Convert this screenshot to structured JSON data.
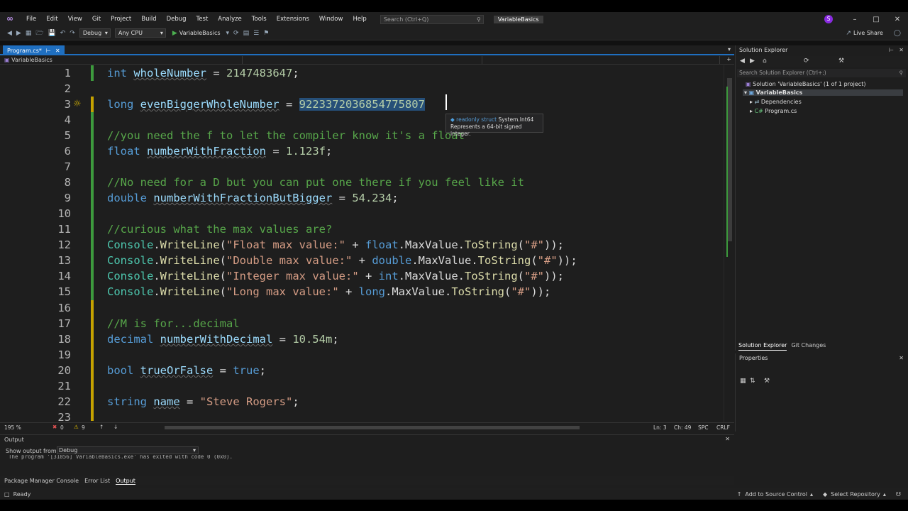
{
  "menu": [
    "File",
    "Edit",
    "View",
    "Git",
    "Project",
    "Build",
    "Debug",
    "Test",
    "Analyze",
    "Tools",
    "Extensions",
    "Window",
    "Help"
  ],
  "search_placeholder": "Search (Ctrl+Q)",
  "solution_name": "VariableBasics",
  "user_initial": "S",
  "toolbar": {
    "config": "Debug",
    "platform": "Any CPU",
    "run_label": "VariableBasics",
    "live_share": "Live Share"
  },
  "editor_tab": {
    "label": "Program.cs*"
  },
  "nav": {
    "scope": "VariableBasics"
  },
  "code": {
    "l1_kw": "int",
    "l1_id": "wholeNumber",
    "l1_rest": " = ",
    "l1_num": "2147483647",
    "l1_end": ";",
    "l3_kw": "long",
    "l3_id": "evenBiggerWholeNumber",
    "l3_rest": " = ",
    "l3_num": "9223372036854775807",
    "l5_cm": "//you need the f to let the compiler know it's a float",
    "l6_kw": "float",
    "l6_id": "numberWithFraction",
    "l6_rest": " = ",
    "l6_num": "1.123f",
    "l6_end": ";",
    "l8_cm": "//No need for a D but you can put one there if you feel like it",
    "l9_kw": "double",
    "l9_id": "numberWithFractionButBigger",
    "l9_rest": " = ",
    "l9_num": "54.234",
    "l9_end": ";",
    "l11_cm": "//curious what the max values are?",
    "l12_str": "\"Float max value:\"",
    "l12_kw": "float",
    "l13_str": "\"Double max value:\"",
    "l13_kw": "double",
    "l14_str": "\"Integer max value:\"",
    "l14_kw": "int",
    "l15_str": "\"Long max value:\"",
    "l15_kw": "long",
    "console": "Console",
    "writeline": "WriteLine",
    "maxvalue": "MaxValue",
    "tostring": "ToString",
    "hash": "\"#\"",
    "l17_cm": "//M is for...decimal",
    "l18_kw": "decimal",
    "l18_id": "numberWithDecimal",
    "l18_rest": " = ",
    "l18_num": "10.54m",
    "l18_end": ";",
    "l20_kw": "bool",
    "l20_id": "trueOrFalse",
    "l20_rest": " = ",
    "l20_val": "true",
    "l20_end": ";",
    "l22_kw": "string",
    "l22_id": "name",
    "l22_rest": " = ",
    "l22_str": "\"Steve Rogers\"",
    "l22_end": ";"
  },
  "line_numbers": [
    "1",
    "2",
    "3",
    "4",
    "5",
    "6",
    "7",
    "8",
    "9",
    "10",
    "11",
    "12",
    "13",
    "14",
    "15",
    "16",
    "17",
    "18",
    "19",
    "20",
    "21",
    "22",
    "23"
  ],
  "tooltip": {
    "line1_kind": "readonly struct",
    "line1_type": "System.Int64",
    "line2": "Represents a 64-bit signed integer."
  },
  "editor_status": {
    "zoom": "195 %",
    "errors": "0",
    "warnings": "9",
    "ln": "Ln: 3",
    "ch": "Ch: 49",
    "spc": "SPC",
    "crlf": "CRLF"
  },
  "solution_explorer": {
    "title": "Solution Explorer",
    "search": "Search Solution Explorer (Ctrl+;)",
    "solution": "Solution 'VariableBasics' (1 of 1 project)",
    "project": "VariableBasics",
    "dependencies": "Dependencies",
    "file": "Program.cs",
    "tab1": "Solution Explorer",
    "tab2": "Git Changes"
  },
  "properties": {
    "title": "Properties"
  },
  "output": {
    "title": "Output",
    "show_from": "Show output from:",
    "source": "Debug",
    "text": "The program '[31856] VariableBasics.exe' has exited with code 0 (0x0)."
  },
  "bottom_tabs": [
    "Package Manager Console",
    "Error List",
    "Output"
  ],
  "status": {
    "ready": "Ready",
    "add_source": "Add to Source Control",
    "select_repo": "Select Repository"
  }
}
